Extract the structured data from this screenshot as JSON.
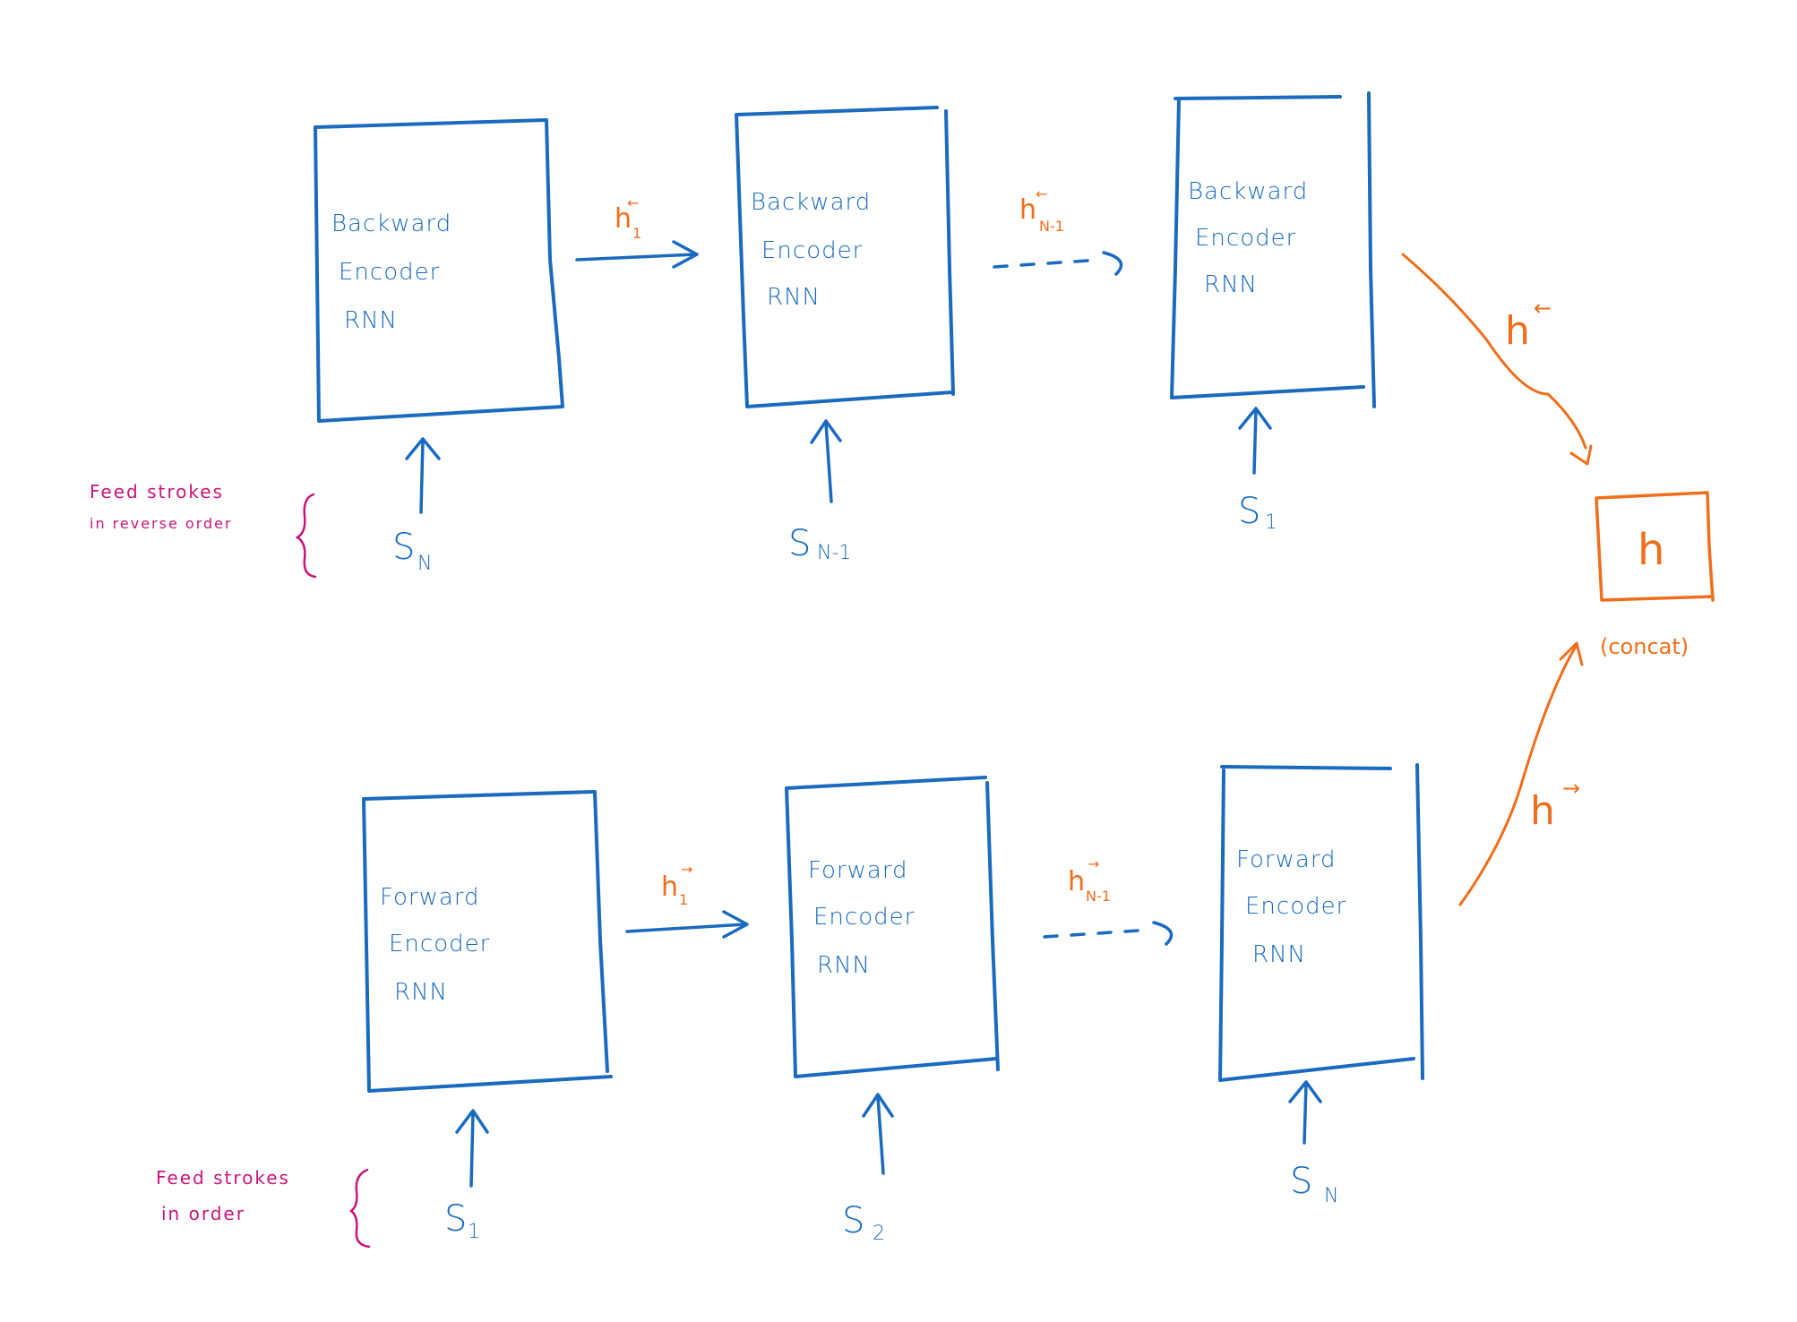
{
  "encoders": {
    "backward": [
      {
        "lines": [
          "Backward",
          "Encoder",
          "RNN"
        ],
        "input_main": "S",
        "input_sub": "N"
      },
      {
        "lines": [
          "Backward",
          "Encoder",
          "RNN"
        ],
        "input_main": "S",
        "input_sub": "N-1"
      },
      {
        "lines": [
          "Backward",
          "Encoder",
          "RNN"
        ],
        "input_main": "S",
        "input_sub": "1"
      }
    ],
    "forward": [
      {
        "lines": [
          "Forward",
          "Encoder",
          "RNN"
        ],
        "input_main": "S",
        "input_sub": "1"
      },
      {
        "lines": [
          "Forward",
          "Encoder",
          "RNN"
        ],
        "input_main": "S",
        "input_sub": "2"
      },
      {
        "lines": [
          "Forward",
          "Encoder",
          "RNN"
        ],
        "input_main": "S",
        "input_sub": "N"
      }
    ]
  },
  "hidden_labels": {
    "backward": [
      {
        "main": "h",
        "sub": "1",
        "accent": "←"
      },
      {
        "main": "h",
        "sub": "N-1",
        "accent": "←"
      }
    ],
    "forward": [
      {
        "main": "h",
        "sub": "1",
        "accent": "→"
      },
      {
        "main": "h",
        "sub": "N-1",
        "accent": "→"
      }
    ],
    "backward_final": {
      "main": "h",
      "accent": "←"
    },
    "forward_final": {
      "main": "h",
      "accent": "→"
    }
  },
  "output": {
    "label": "h",
    "caption": "(concat)"
  },
  "notes": {
    "backward": [
      "Feed strokes",
      "in reverse order"
    ],
    "forward": [
      "Feed strokes",
      "in order"
    ]
  },
  "colors": {
    "encoder": "#1a6bbf",
    "hidden": "#f06e1a",
    "note": "#c8147a"
  }
}
